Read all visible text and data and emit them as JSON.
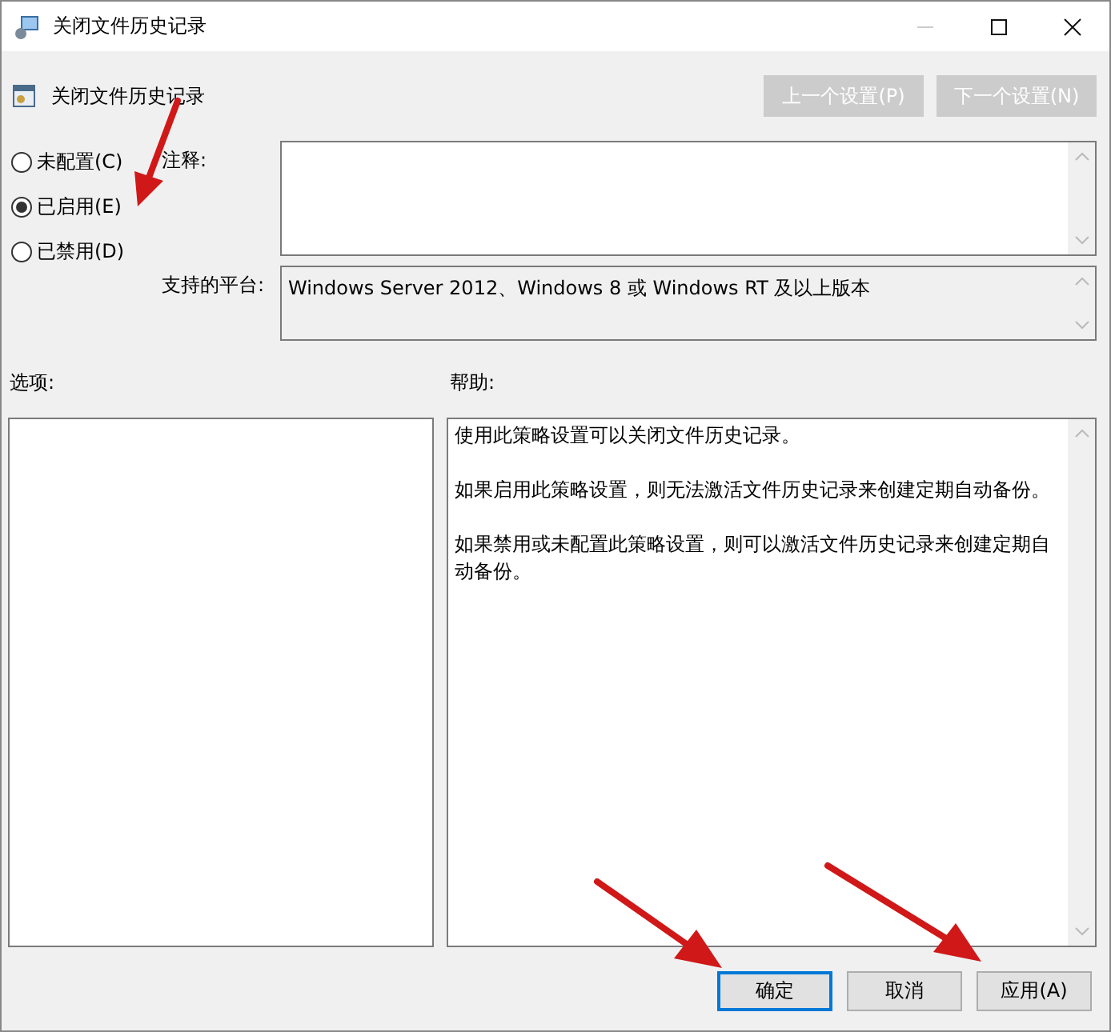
{
  "window": {
    "title": "关闭文件历史记录"
  },
  "header": {
    "title": "关闭文件历史记录",
    "buttons": [
      {
        "label": "上一个设置(P)",
        "disabled": true
      },
      {
        "label": "下一个设置(N)",
        "disabled": true
      }
    ]
  },
  "state_options": [
    {
      "label": "未配置(C)",
      "selected": false
    },
    {
      "label": "已启用(E)",
      "selected": true
    },
    {
      "label": "已禁用(D)",
      "selected": false
    }
  ],
  "comment": {
    "label": "注释:"
  },
  "platform": {
    "label": "支持的平台:",
    "value": "Windows Server 2012、Windows 8 或 Windows RT 及以上版本"
  },
  "options": {
    "label": "选项:"
  },
  "help": {
    "label": "帮助:",
    "paragraphs": [
      "使用此策略设置可以关闭文件历史记录。",
      "如果启用此策略设置，则无法激活文件历史记录来创建定期自动备份。",
      "如果禁用或未配置此策略设置，则可以激活文件历史记录来创建定期自动备份。"
    ]
  },
  "buttons": [
    {
      "label": "确定",
      "default": true
    },
    {
      "label": "取消",
      "default": false
    },
    {
      "label": "应用(A)",
      "default": false
    }
  ]
}
